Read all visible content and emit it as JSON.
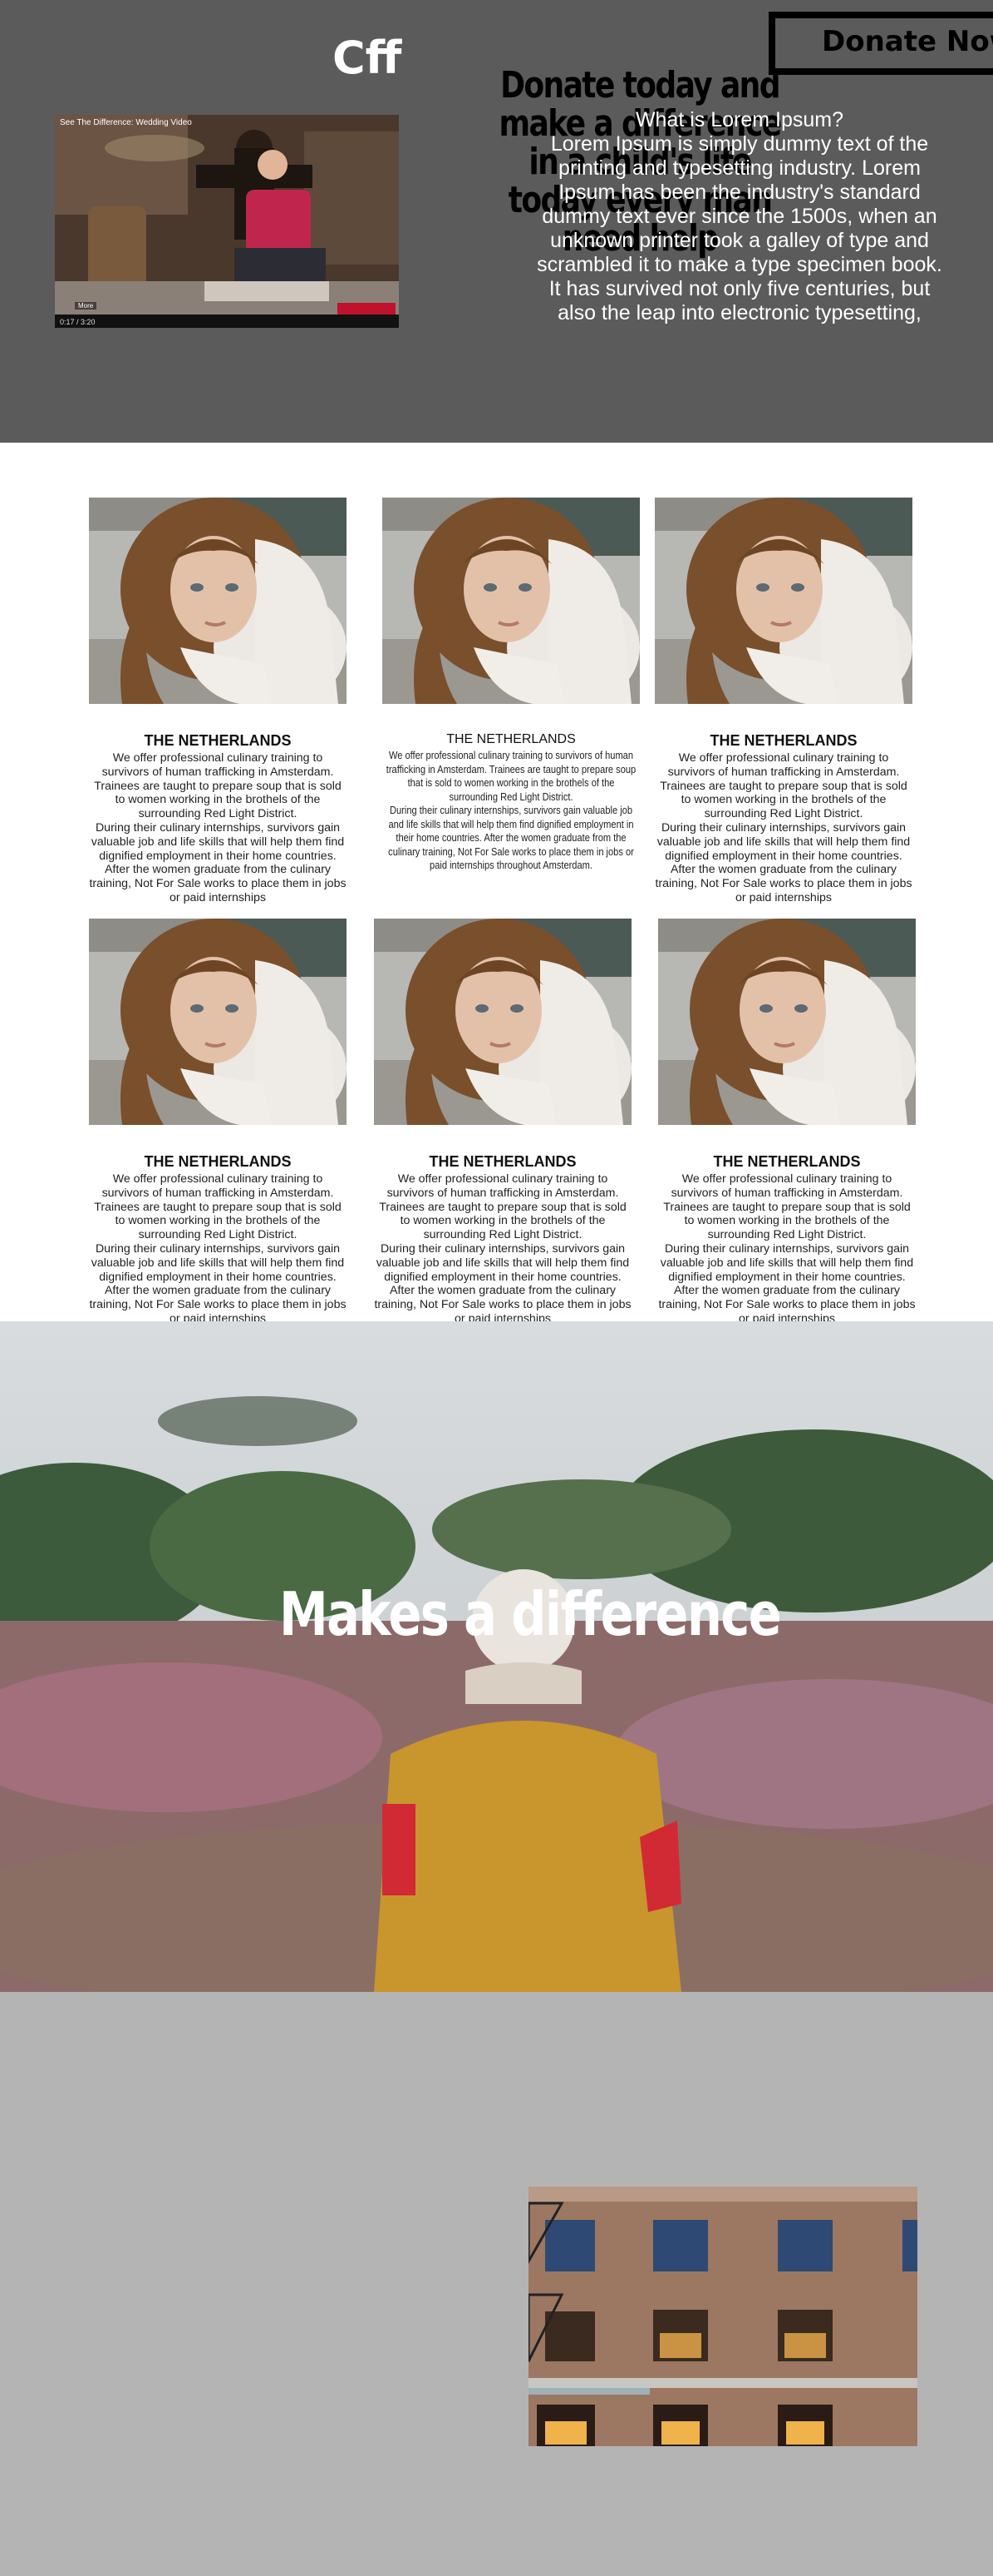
{
  "header": {
    "logo": "Cff",
    "donate_label": "Donate Now",
    "tagline": "Donate today and make a difference in a child's life today every man need help",
    "lorem_heading": "What is Lorem Ipsum?",
    "lorem_body": "Lorem Ipsum is simply dummy text of the printing and typesetting industry. Lorem Ipsum has been the industry's standard dummy text ever since the 1500s, when an unknown printer took a galley of type and scrambled it to make a type specimen book. It has survived not only five centuries, but also the leap into electronic typesetting,"
  },
  "video": {
    "title": "See The Difference: Wedding Video",
    "time": "0:17 / 3:20",
    "more": "More"
  },
  "cards": [
    {
      "title": "THE NETHERLANDS",
      "text": "We offer professional culinary training to survivors of human trafficking in Amsterdam. Trainees are taught to prepare soup that is sold to women working in the brothels of the surrounding Red Light District.\nDuring their culinary internships, survivors gain valuable job and life skills that will help them find dignified employment in their home countries. After the women graduate from the culinary training, Not For Sale works to place them in jobs or paid internships"
    },
    {
      "title": "THE NETHERLANDS",
      "text": "We offer professional culinary training to survivors of human trafficking in Amsterdam. Trainees are taught to prepare soup that is sold to women working in the brothels of the surrounding Red Light District.\nDuring their culinary internships, survivors gain valuable job and life skills that will help them find dignified employment in their home countries. After the women graduate from the culinary training, Not For Sale works to place them in jobs or paid internships throughout Amsterdam."
    },
    {
      "title": "THE NETHERLANDS",
      "text": "We offer professional culinary training to survivors of human trafficking in Amsterdam. Trainees are taught to prepare soup that is sold to women working in the brothels of the surrounding Red Light District.\nDuring their culinary internships, survivors gain valuable job and life skills that will help them find dignified employment in their home countries. After the women graduate from the culinary training, Not For Sale works to place them in jobs or paid internships"
    },
    {
      "title": "THE NETHERLANDS",
      "text": "We offer professional culinary training to survivors of human trafficking in Amsterdam. Trainees are taught to prepare soup that is sold to women working in the brothels of the surrounding Red Light District.\nDuring their culinary internships, survivors gain valuable job and life skills that will help them find dignified employment in their home countries. After the women graduate from the culinary training, Not For Sale works to place them in jobs or paid internships"
    },
    {
      "title": "THE NETHERLANDS",
      "text": "We offer professional culinary training to survivors of human trafficking in Amsterdam. Trainees are taught to prepare soup that is sold to women working in the brothels of the surrounding Red Light District.\nDuring their culinary internships, survivors gain valuable job and life skills that will help them find dignified employment in their home countries. After the women graduate from the culinary training, Not For Sale works to place them in jobs or paid internships"
    },
    {
      "title": "THE NETHERLANDS",
      "text": "We offer professional culinary training to survivors of human trafficking in Amsterdam. Trainees are taught to prepare soup that is sold to women working in the brothels of the surrounding Red Light District.\nDuring their culinary internships, survivors gain valuable job and life skills that will help them find dignified employment in their home countries. After the women graduate from the culinary training, Not For Sale works to place them in jobs or paid internships"
    }
  ],
  "hero": {
    "title": "Makes a difference"
  },
  "colors": {
    "header_bg": "#5b5b5b",
    "bottom_bg": "#b4b4b4",
    "jacket": "#c8962c"
  }
}
